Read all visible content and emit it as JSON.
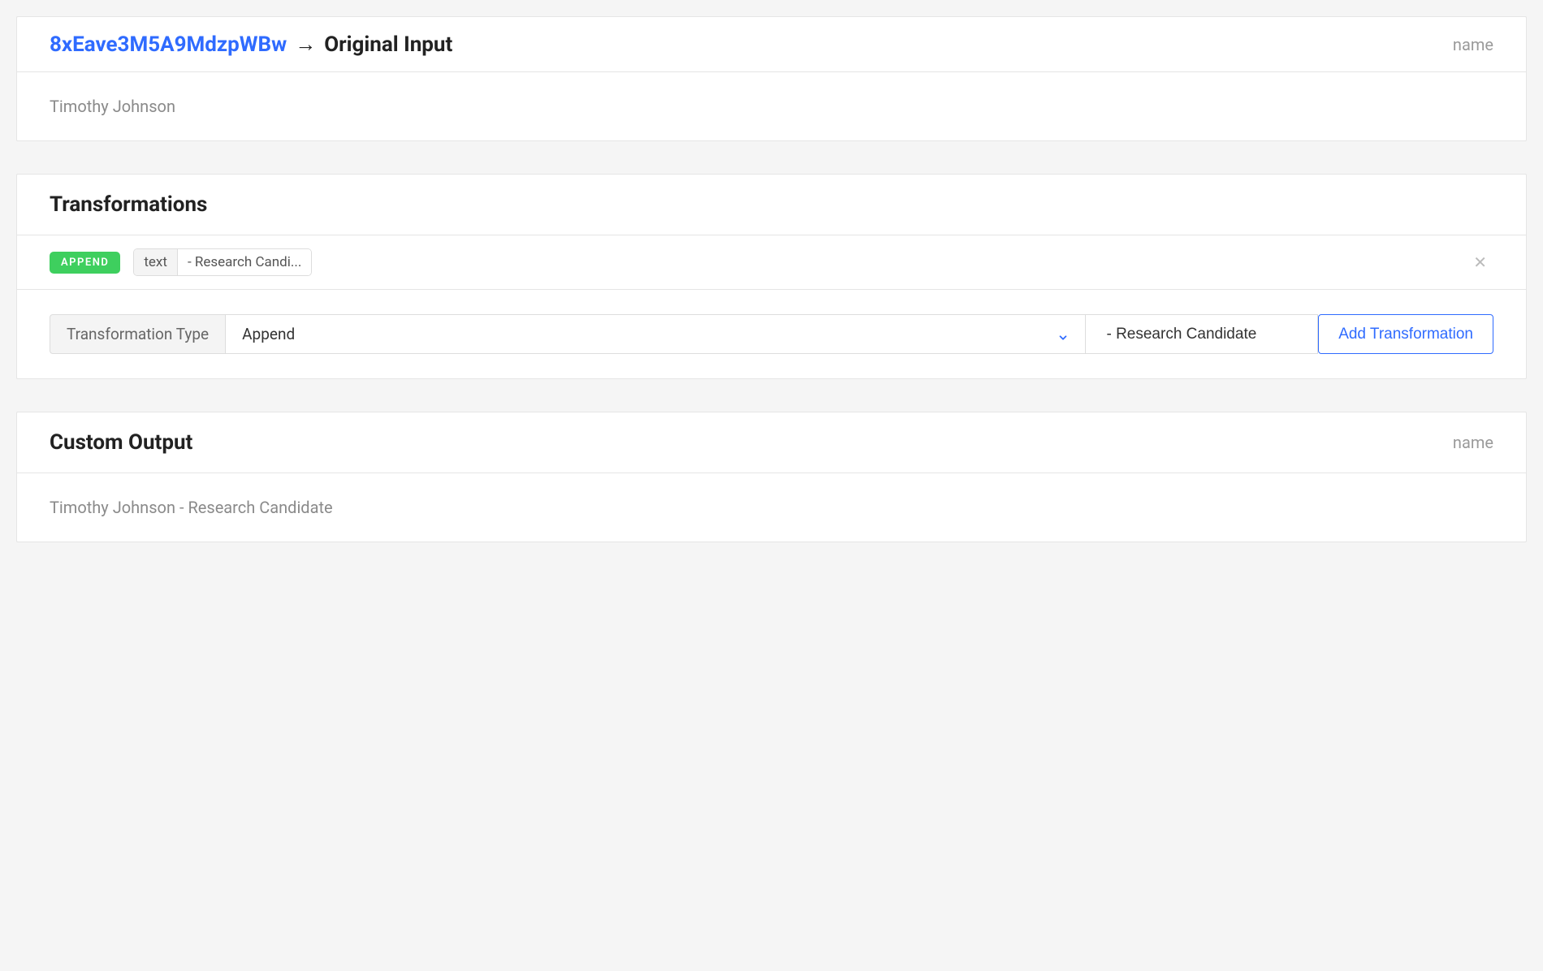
{
  "originalInput": {
    "linkId": "8xEave3M5A9MdzpWBw",
    "arrow": "→",
    "title": "Original Input",
    "fieldLabel": "name",
    "value": "Timothy Johnson"
  },
  "transformations": {
    "title": "Transformations",
    "items": [
      {
        "badge": "APPEND",
        "paramLabel": "text",
        "paramValue": " - Research Candi..."
      }
    ],
    "form": {
      "typeLabel": "Transformation Type",
      "selectedType": "Append",
      "inputValue": " - Research Candidate",
      "addButton": "Add Transformation"
    }
  },
  "customOutput": {
    "title": "Custom Output",
    "fieldLabel": "name",
    "value": "Timothy Johnson - Research Candidate"
  }
}
